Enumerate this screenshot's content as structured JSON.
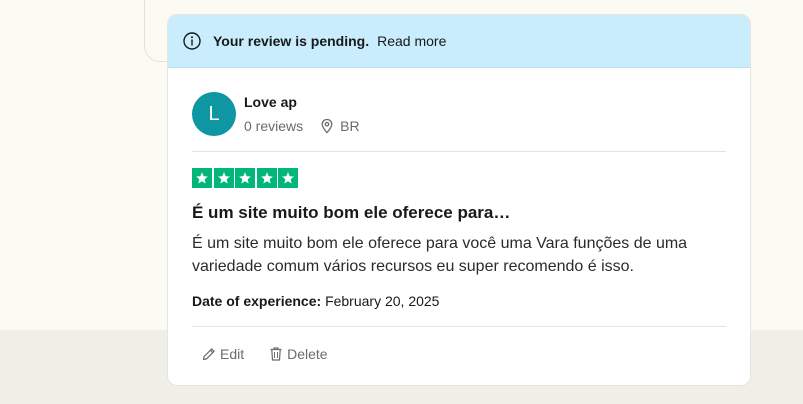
{
  "banner": {
    "icon": "info-icon",
    "message": "Your review is pending.",
    "link": "Read more"
  },
  "reviewer": {
    "initial": "L",
    "name": "Love ap",
    "review_count": "0 reviews",
    "country": "BR",
    "avatar_color": "#0e97a3"
  },
  "review": {
    "rating": 5,
    "star_color": "#00b67a",
    "title": "É um site muito bom ele oferece para…",
    "text": "É um site muito bom ele oferece para você uma Vara funções de uma variedade comum vários recursos eu super recomendo é isso.",
    "experience_label": "Date of experience:",
    "experience_date": "February 20, 2025"
  },
  "actions": {
    "edit": "Edit",
    "delete": "Delete"
  },
  "colors": {
    "banner_bg": "#c9edfc",
    "page_bg": "#fcfbf3"
  }
}
